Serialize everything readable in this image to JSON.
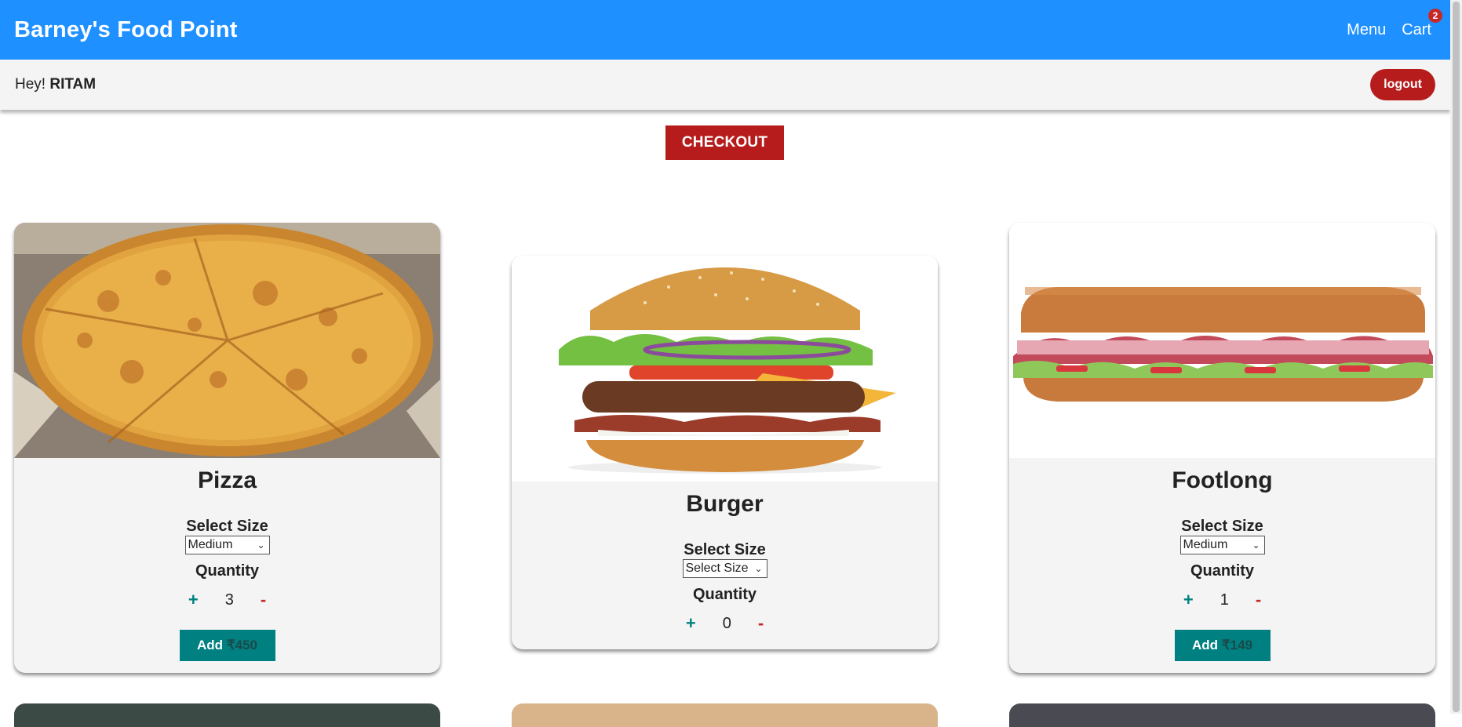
{
  "navbar": {
    "brand": "Barney's Food Point",
    "menu_label": "Menu",
    "cart_label": "Cart",
    "cart_count": "2"
  },
  "greeting": {
    "prefix": "Hey!",
    "username": "RITAM",
    "logout_label": "logout"
  },
  "checkout_label": "CHECKOUT",
  "labels": {
    "select_size": "Select Size",
    "quantity": "Quantity",
    "plus": "+",
    "minus": "-",
    "add": "Add"
  },
  "items": [
    {
      "name": "Pizza",
      "size": "Medium",
      "quantity": "3",
      "price": "₹450"
    },
    {
      "name": "Burger",
      "size": "Select Size",
      "quantity": "0",
      "price": ""
    },
    {
      "name": "Footlong",
      "size": "Medium",
      "quantity": "1",
      "price": "₹149"
    }
  ],
  "colors": {
    "navbar": "#1e90ff",
    "danger": "#b71c1c",
    "teal": "#008080"
  }
}
